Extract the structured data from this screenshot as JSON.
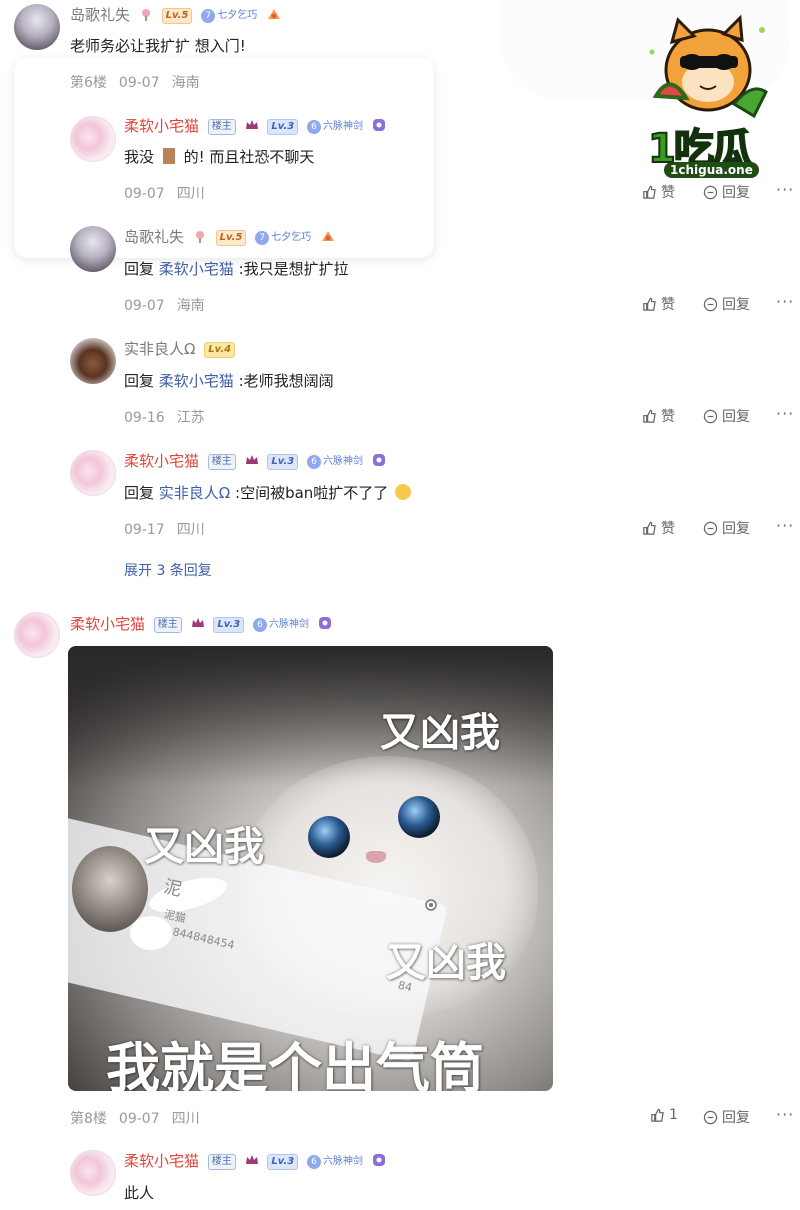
{
  "colors": {
    "mention": "#3f5fa6",
    "name_red": "#e0463c",
    "meta_grey": "#9a9a9a",
    "logo_green": "#3a9b21"
  },
  "logo": {
    "word": "1吃瓜",
    "url": "1chigua.one"
  },
  "comment1": {
    "author": "岛歌礼失",
    "level": "Lv.5",
    "tag_num": "7",
    "tag": "七夕乞巧",
    "text": "老师务必让我扩扩 想入门!",
    "floor": "第6楼",
    "date": "09-07",
    "location": "海南"
  },
  "replies": [
    {
      "author": "柔软小宅猫",
      "owner": "楼主",
      "level": "Lv.3",
      "tag": "六脉神剑",
      "text_a": "我没",
      "text_b": "的! 而且社恐不聊天",
      "date": "09-07",
      "location": "四川",
      "like": "赞",
      "reply": "回复"
    },
    {
      "author": "岛歌礼失",
      "level": "Lv.5",
      "tag_num": "7",
      "tag": "七夕乞巧",
      "prefix": "回复",
      "mention": "柔软小宅猫",
      "text": " :我只是想扩扩拉",
      "date": "09-07",
      "location": "海南",
      "like": "赞",
      "reply": "回复"
    },
    {
      "author": "实非良人Ω",
      "level": "Lv.4",
      "prefix": "回复",
      "mention": "柔软小宅猫",
      "text": " :老师我想阔阔",
      "date": "09-16",
      "location": "江苏",
      "like": "赞",
      "reply": "回复"
    },
    {
      "author": "柔软小宅猫",
      "owner": "楼主",
      "level": "Lv.3",
      "tag": "六脉神剑",
      "prefix": "回复",
      "mention": "实非良人Ω",
      "text": " :空间被ban啦扩不了了",
      "date": "09-17",
      "location": "四川",
      "like": "赞",
      "reply": "回复"
    }
  ],
  "expand_label": "展开 3 条回复",
  "comment2": {
    "author": "柔软小宅猫",
    "owner": "楼主",
    "level": "Lv.3",
    "tag": "六脉神剑",
    "meme_captions": [
      "又凶我",
      "又凶我",
      "又凶我",
      "我就是个出气筒"
    ],
    "meme_small": [
      "泥",
      "泥猫",
      "844848454",
      "84"
    ],
    "floor": "第8楼",
    "date": "09-07",
    "location": "四川",
    "like_count": "1",
    "reply": "回复"
  },
  "reply_last": {
    "author": "柔软小宅猫",
    "owner": "楼主",
    "level": "Lv.3",
    "tag": "六脉神剑",
    "text": "此人"
  },
  "more": "···"
}
